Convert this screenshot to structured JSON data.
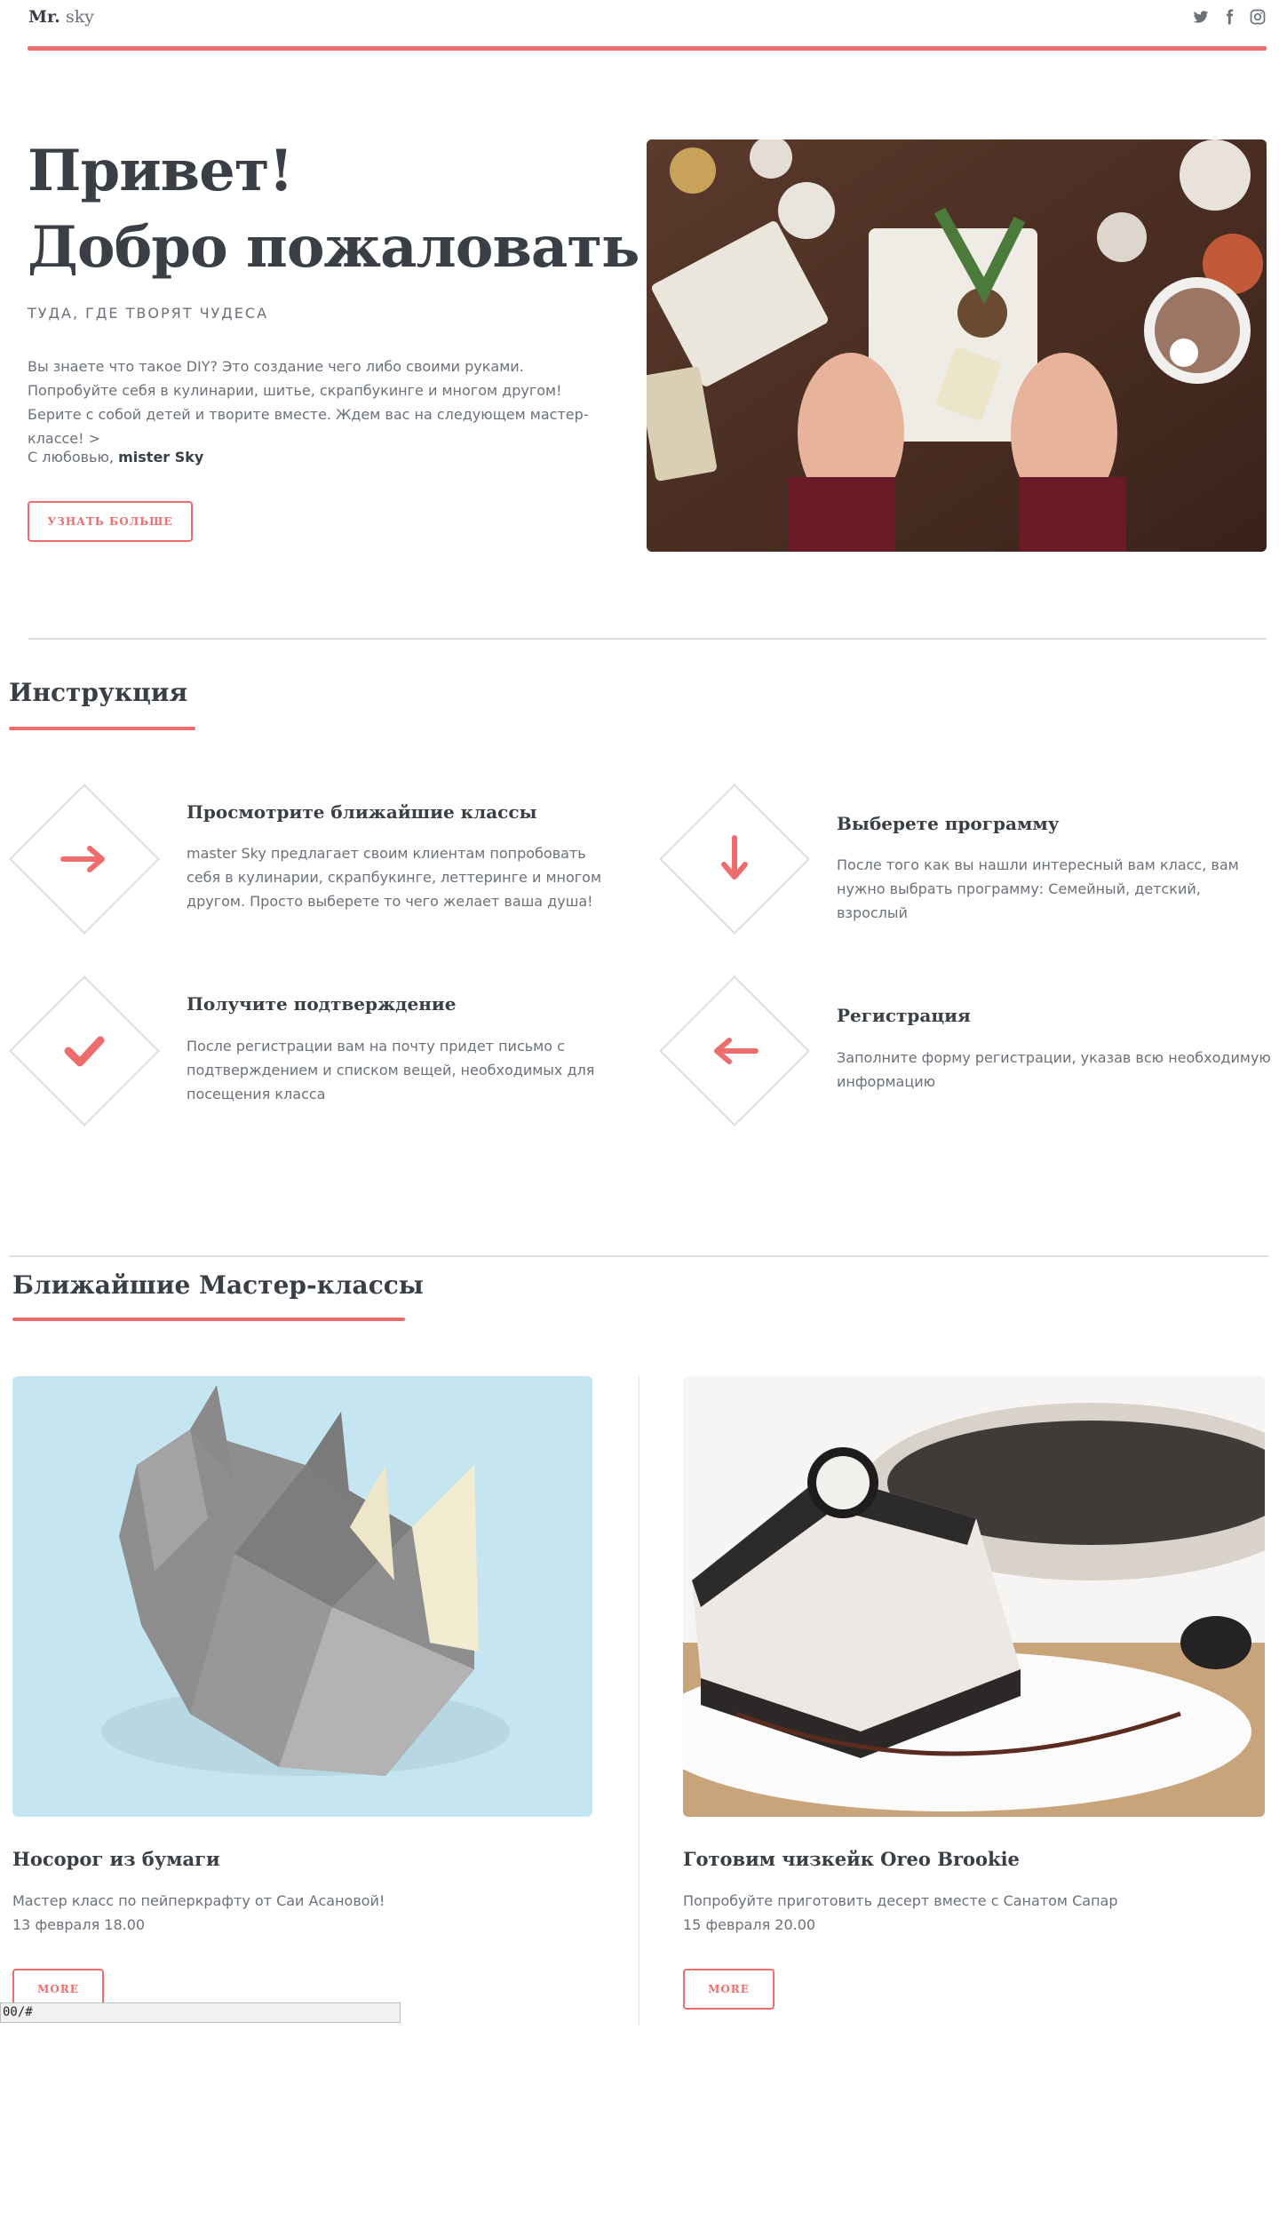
{
  "header": {
    "logo_bold": "Mr.",
    "logo_light": "sky",
    "social": [
      "twitter-icon",
      "facebook-icon",
      "instagram-icon"
    ]
  },
  "hero": {
    "title_line1": "Привет!",
    "title_line2": "Добро пожаловать",
    "subtitle": "ТУДА, ГДЕ ТВОРЯТ ЧУДЕСА",
    "text": "Вы знаете что такое DIY? Это создание чего либо своими руками. Попробуйте себя в кулинарии, шитье, скрапбукинге и многом другом! Берите с собой детей и творите вместе. Ждем вас на следующем мастер-классе! >",
    "sign_prefix": "С любовью,",
    "sign_name": "mister Sky",
    "button": "УЗНАТЬ БОЛЬШЕ"
  },
  "instructions": {
    "title": "Инструкция",
    "steps": [
      {
        "icon": "arrow-right-icon",
        "title": "Просмотрите ближайшие классы",
        "text": "master Sky предлагает своим клиентам попробовать себя в кулинарии, скрапбукинге, леттеринге и многом другом. Просто выберете то чего желает ваша душа!"
      },
      {
        "icon": "arrow-down-icon",
        "title": "Выберете программу",
        "text": "После того как вы нашли интересный вам класс, вам нужно выбрать программу: Семейный, детский, взрослый"
      },
      {
        "icon": "checkmark-icon",
        "title": "Получите подтверждение",
        "text": "После регистрации вам на почту придет письмо с подтверждением и списком вещей, необходимых для посещения класса"
      },
      {
        "icon": "arrow-left-icon",
        "title": "Регистрация",
        "text": "Заполните форму регистрации, указав всю необходимую информацию"
      }
    ]
  },
  "classes": {
    "title": "Ближайшие Мастер-классы",
    "cards": [
      {
        "title": "Носорог из бумаги",
        "desc": "Мастер класс по пейперкрафту от Саи Асановой!",
        "date": "13 февраля 18.00",
        "button": "MORE",
        "image_label": "paper-rhino-image"
      },
      {
        "title": "Готовим чизкейк Oreo Brookie",
        "desc": "Попробуйте приготовить десерт вместе с Санатом Сапар",
        "date": "15 февраля 20.00",
        "button": "MORE",
        "image_label": "oreo-cheesecake-image"
      }
    ]
  },
  "statusbar": {
    "url": "00/#"
  },
  "colors": {
    "accent": "#ef6c6c",
    "text": "#3a3f45",
    "muted": "#6b7178"
  }
}
